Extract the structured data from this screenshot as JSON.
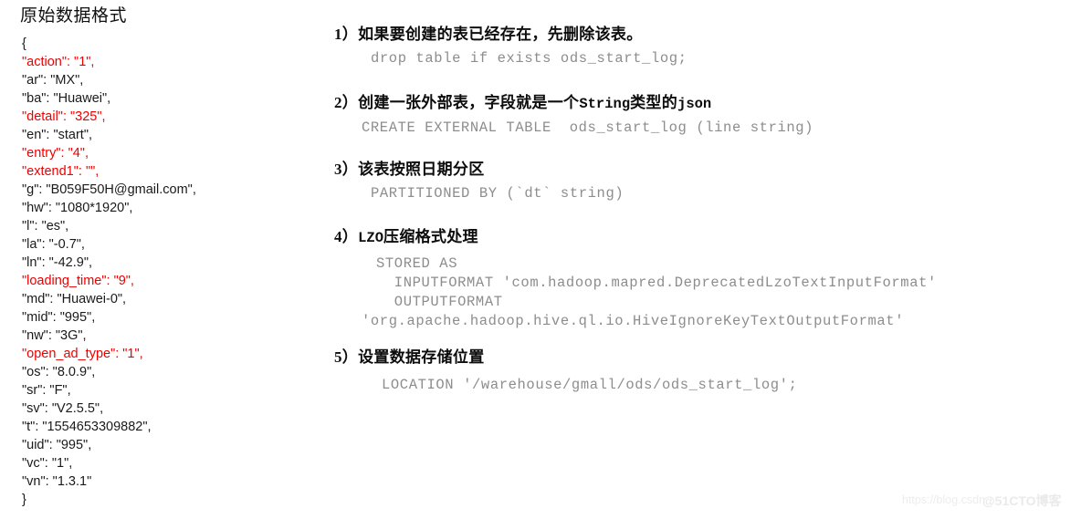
{
  "left": {
    "title": "原始数据格式",
    "json_lines": [
      {
        "text": "{",
        "highlight": false
      },
      {
        "text": "\"action\": \"1\",",
        "highlight": true
      },
      {
        "text": "\"ar\": \"MX\",",
        "highlight": false
      },
      {
        "text": "\"ba\": \"Huawei\",",
        "highlight": false
      },
      {
        "text": "\"detail\": \"325\",",
        "highlight": true
      },
      {
        "text": "\"en\": \"start\",",
        "highlight": false
      },
      {
        "text": "\"entry\": \"4\",",
        "highlight": true
      },
      {
        "text": "\"extend1\": \"\",",
        "highlight": true
      },
      {
        "text": "\"g\": \"B059F50H@gmail.com\",",
        "highlight": false
      },
      {
        "text": "\"hw\": \"1080*1920\",",
        "highlight": false
      },
      {
        "text": "\"l\": \"es\",",
        "highlight": false
      },
      {
        "text": "\"la\": \"-0.7\",",
        "highlight": false
      },
      {
        "text": "\"ln\": \"-42.9\",",
        "highlight": false
      },
      {
        "text": "\"loading_time\": \"9\",",
        "highlight": true
      },
      {
        "text": "\"md\": \"Huawei-0\",",
        "highlight": false
      },
      {
        "text": "\"mid\": \"995\",",
        "highlight": false
      },
      {
        "text": "\"nw\": \"3G\",",
        "highlight": false
      },
      {
        "text": "\"open_ad_type\": \"1\",",
        "highlight": true
      },
      {
        "text": "\"os\": \"8.0.9\",",
        "highlight": false
      },
      {
        "text": "\"sr\": \"F\",",
        "highlight": false
      },
      {
        "text": "\"sv\": \"V2.5.5\",",
        "highlight": false
      },
      {
        "text": "\"t\": \"1554653309882\",",
        "highlight": false
      },
      {
        "text": "\"uid\": \"995\",",
        "highlight": false
      },
      {
        "text": "\"vc\": \"1\",",
        "highlight": false
      },
      {
        "text": "\"vn\": \"1.3.1\"",
        "highlight": false
      },
      {
        "text": "}",
        "highlight": false
      }
    ]
  },
  "right": {
    "step1": {
      "heading": "1）如果要创建的表已经存在，先删除该表。",
      "code": "drop table if exists ods_start_log;"
    },
    "step2": {
      "heading_pre": "2）创建一张外部表，字段就是一个",
      "heading_mono1": "String",
      "heading_mid": "类型的",
      "heading_mono2": "json",
      "code": "CREATE EXTERNAL TABLE  ods_start_log (line string)"
    },
    "step3": {
      "heading": "3）该表按照日期分区",
      "code": "PARTITIONED BY (`dt` string)"
    },
    "step4": {
      "heading_num": "4）",
      "heading_mono": "LZO",
      "heading_rest": "压缩格式处理",
      "code_line1": "STORED AS",
      "code_line2": "  INPUTFORMAT 'com.hadoop.mapred.DeprecatedLzoTextInputFormat'",
      "code_line3": "  OUTPUTFORMAT",
      "code_line4": "'org.apache.hadoop.hive.ql.io.HiveIgnoreKeyTextOutputFormat'"
    },
    "step5": {
      "heading": "5）设置数据存储位置",
      "code": "LOCATION '/warehouse/gmall/ods/ods_start_log';"
    }
  },
  "watermark": {
    "url": "https://blog.csdn",
    "brand": "@51CTO博客"
  },
  "colors": {
    "highlight_red": "#ee0000",
    "body_text": "#1a1a1a",
    "code_gray": "#8d8d8d",
    "watermark_gray": "#ededed",
    "background": "#ffffff"
  }
}
